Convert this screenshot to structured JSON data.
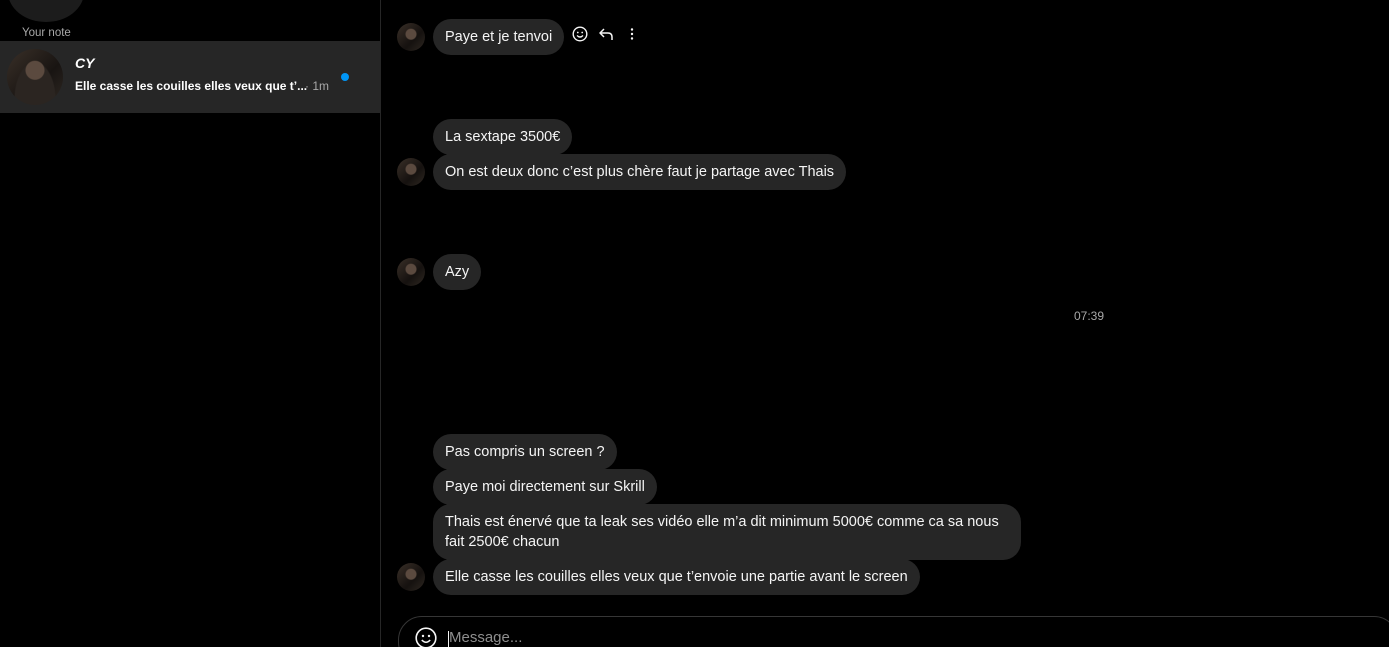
{
  "sidebar": {
    "note_label": "Your note",
    "thread": {
      "name": "CY",
      "preview": "Elle casse les couilles elles veux que t’...",
      "time": "· 1m",
      "unread_color": "#0095f6"
    }
  },
  "messages": {
    "m1": "Paye et je tenvoi",
    "m2": "La sextape 3500€",
    "m3": "On est deux donc c’est plus chère faut je partage avec Thais",
    "m4": "Azy",
    "timestamp": "07:39",
    "m5": "Pas compris un screen ?",
    "m6": "Paye moi directement sur Skrill",
    "m7": "Thais est énervé que ta leak ses vidéo elle m’a dit minimum 5000€ comme ca sa nous fait 2500€ chacun",
    "m8": "Elle casse les couilles elles veux que t’envoie une partie avant le screen"
  },
  "composer": {
    "placeholder": "Message..."
  },
  "icons": {
    "react": "smiley-icon",
    "reply": "reply-arrow-icon",
    "more": "more-vertical-icon",
    "emoji": "smiley-icon"
  }
}
